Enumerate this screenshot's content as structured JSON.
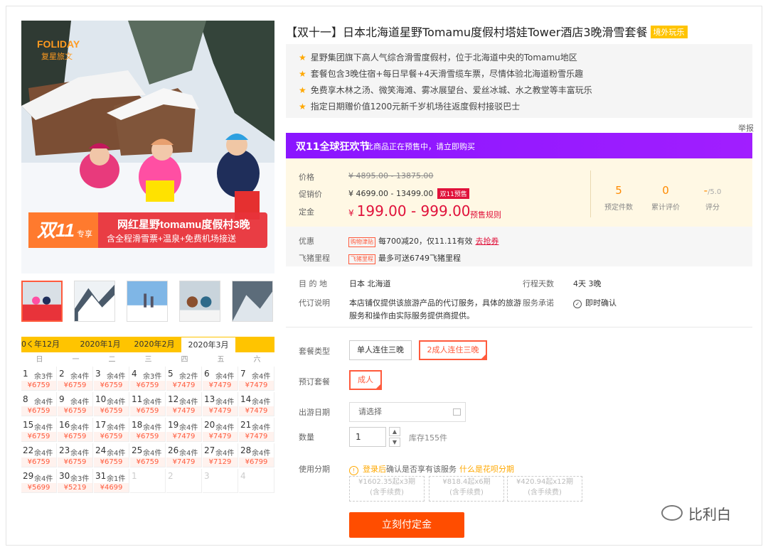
{
  "product": {
    "title": "【双十一】日本北海道星野Tomamu度假村塔娃Tower酒店3晚滑雪套餐",
    "tag": "境外玩乐",
    "features": [
      "星野集团旗下高人气综合滑雪度假村，位于北海道中央的Tomamu地区",
      "套餐包含3晚住宿+每日早餐+4天滑雪缆车票，尽情体验北海道粉雪乐趣",
      "免费享木林之汤、微笑海滩、雾冰展望台、爱丝冰城、水之教堂等丰富玩乐",
      "指定日期赠价值1200元新千岁机场往返度假村接驳巴士"
    ],
    "report": "举报"
  },
  "hero": {
    "brand": "FOLIDAY",
    "brand_sub": "复星旅文",
    "badge_main": "双11",
    "badge_sub": "专享",
    "banner_line1": "网红星野tomamu度假村3晚",
    "banner_line2": "含全程滑雪票+温泉+免费机场接送"
  },
  "promo": {
    "logo": "双11全球狂欢节",
    "text": "此商品正在预售中，请立即购买"
  },
  "pricing": {
    "price_label": "价格",
    "price": "¥ 4895.00 - 13875.00",
    "promo_label": "促销价",
    "promo_price": "¥ 4699.00 - 13499.00",
    "promo_badge": "双11预售",
    "deposit_label": "定金",
    "deposit_currency": "¥",
    "deposit": "199.00 - 999.00",
    "deposit_link": "预售规则",
    "stats": [
      {
        "num": "5",
        "label": "预定件数"
      },
      {
        "num": "0",
        "label": "累计评价"
      },
      {
        "num": "-",
        "small": "/5.0",
        "label": "评分"
      }
    ]
  },
  "benefits": {
    "discount_label": "优惠",
    "discount_tag": "购物津贴",
    "discount_text": "每700减20，仅11.11有效",
    "discount_link": "去抢券",
    "miles_label": "飞猪里程",
    "miles_tag": "飞猪里程",
    "miles_text": "最多可送6749飞猪里程"
  },
  "info": {
    "dest_label": "目 的 地",
    "dest": "日本  北海道",
    "days_label": "行程天数",
    "days": "4天  3晚",
    "agent_label": "代订说明",
    "agent_line1": "本店铺仅提供该旅游产品的代订服务，具体的旅游",
    "agent_line2": "服务和操作由实际服务提供商提供。",
    "promise_label": "服务承诺",
    "promise": "即时确认"
  },
  "options": {
    "package_type_label": "套餐类型",
    "package_types": [
      "单人连住三晚",
      "2成人连住三晚"
    ],
    "booking_label": "预订套餐",
    "booking": "成人",
    "date_label": "出游日期",
    "date_placeholder": "请选择",
    "qty_label": "数量",
    "qty": "1",
    "qty_up": "▲",
    "qty_down": "▼",
    "stock": "库存155件",
    "installment_label": "使用分期",
    "installment_warn": "!",
    "installment_login": "登录后",
    "installment_note": "确认是否享有该服务",
    "installment_link": "什么是花呗分期",
    "installments": [
      {
        "line1": "¥1602.35起x3期",
        "line2": "(含手续费)"
      },
      {
        "line1": "¥818.4起x6期",
        "line2": "(含手续费)"
      },
      {
        "line1": "¥420.94起x12期",
        "line2": "(含手续费)"
      }
    ],
    "buy_button": "立刻付定金"
  },
  "calendar": {
    "prev": "0く年12月",
    "tabs": [
      "2020年1月",
      "2020年2月",
      "2020年3月"
    ],
    "weekdays": [
      "日",
      "一",
      "二",
      "三",
      "四",
      "五",
      "六"
    ],
    "days": [
      {
        "d": "1",
        "s": "余3件",
        "p": "¥6759"
      },
      {
        "d": "2",
        "s": "余4件",
        "p": "¥6759"
      },
      {
        "d": "3",
        "s": "余4件",
        "p": "¥6759"
      },
      {
        "d": "4",
        "s": "余3件",
        "p": "¥6759"
      },
      {
        "d": "5",
        "s": "余2件",
        "p": "¥7479"
      },
      {
        "d": "6",
        "s": "余4件",
        "p": "¥7479"
      },
      {
        "d": "7",
        "s": "余4件",
        "p": "¥7479"
      },
      {
        "d": "8",
        "s": "余4件",
        "p": "¥6759"
      },
      {
        "d": "9",
        "s": "余4件",
        "p": "¥6759"
      },
      {
        "d": "10",
        "s": "余4件",
        "p": "¥6759"
      },
      {
        "d": "11",
        "s": "余4件",
        "p": "¥6759"
      },
      {
        "d": "12",
        "s": "余4件",
        "p": "¥7479"
      },
      {
        "d": "13",
        "s": "余4件",
        "p": "¥7479"
      },
      {
        "d": "14",
        "s": "余4件",
        "p": "¥7479"
      },
      {
        "d": "15",
        "s": "余4件",
        "p": "¥6759"
      },
      {
        "d": "16",
        "s": "余4件",
        "p": "¥6759"
      },
      {
        "d": "17",
        "s": "余4件",
        "p": "¥6759"
      },
      {
        "d": "18",
        "s": "余4件",
        "p": "¥6759"
      },
      {
        "d": "19",
        "s": "余4件",
        "p": "¥7479"
      },
      {
        "d": "20",
        "s": "余4件",
        "p": "¥7479"
      },
      {
        "d": "21",
        "s": "余4件",
        "p": "¥7479"
      },
      {
        "d": "22",
        "s": "余4件",
        "p": "¥6759"
      },
      {
        "d": "23",
        "s": "余4件",
        "p": "¥6759"
      },
      {
        "d": "24",
        "s": "余4件",
        "p": "¥6759"
      },
      {
        "d": "25",
        "s": "余4件",
        "p": "¥6759"
      },
      {
        "d": "26",
        "s": "余4件",
        "p": "¥7479"
      },
      {
        "d": "27",
        "s": "余4件",
        "p": "¥7129"
      },
      {
        "d": "28",
        "s": "余4件",
        "p": "¥6799"
      },
      {
        "d": "29",
        "s": "余4件",
        "p": "¥5699"
      },
      {
        "d": "30",
        "s": "余3件",
        "p": "¥5219"
      },
      {
        "d": "31",
        "s": "余1件",
        "p": "¥4699"
      },
      {
        "d": "1",
        "s": "",
        "p": ""
      },
      {
        "d": "2",
        "s": "",
        "p": ""
      },
      {
        "d": "3",
        "s": "",
        "p": ""
      },
      {
        "d": "4",
        "s": "",
        "p": ""
      }
    ]
  },
  "watermark": "比利白",
  "colors": {
    "accent": "#ff5a3c",
    "promo_purple": "#8a16ff",
    "price_red": "#e0113a",
    "calendar_yellow": "#ffc400",
    "buy_orange": "#ff4d00"
  }
}
